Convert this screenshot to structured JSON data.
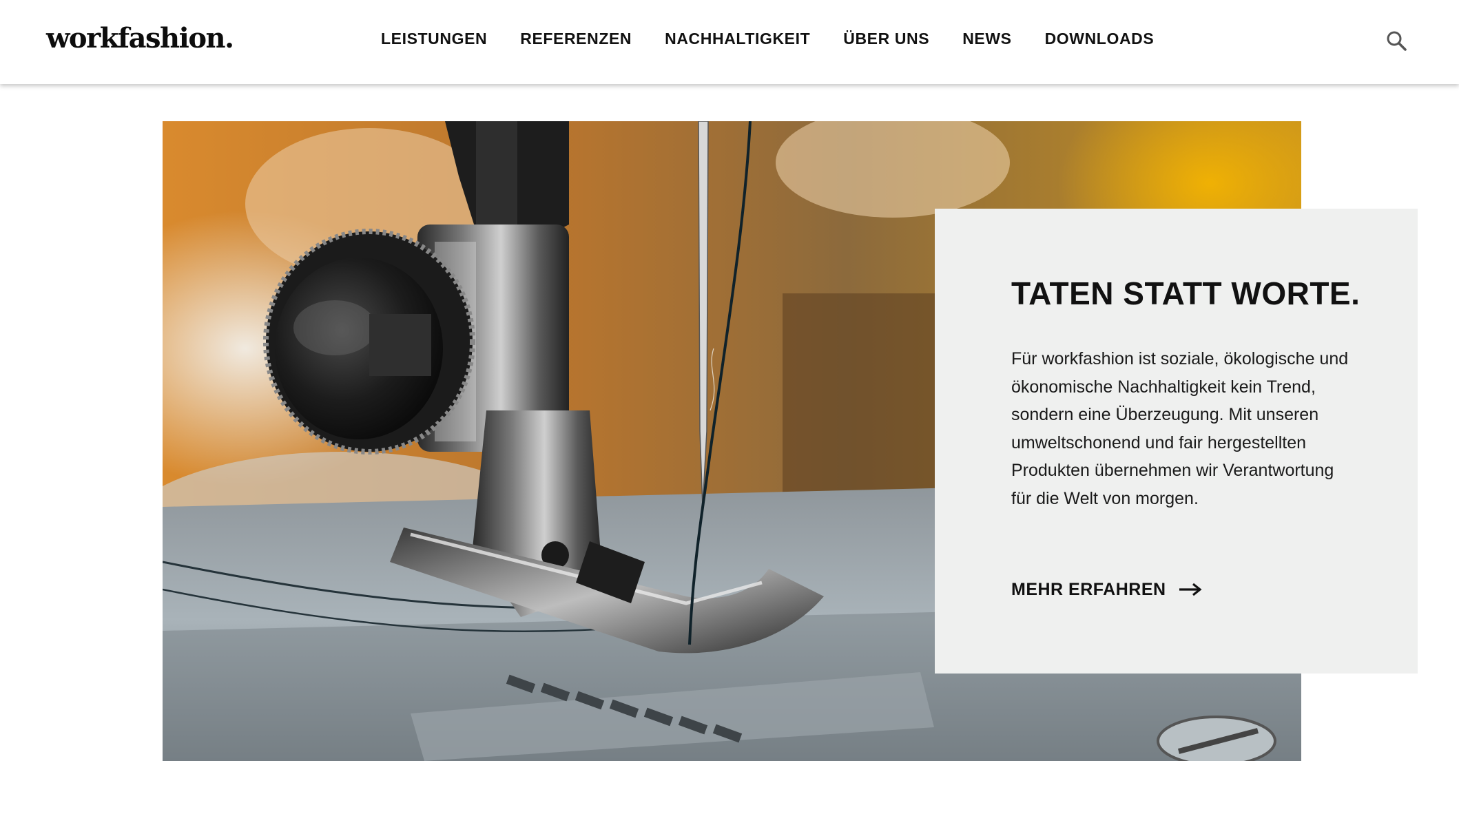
{
  "header": {
    "logo": "workfashion.",
    "nav": [
      {
        "label": "LEISTUNGEN"
      },
      {
        "label": "REFERENZEN"
      },
      {
        "label": "NACHHALTIGKEIT"
      },
      {
        "label": "ÜBER UNS"
      },
      {
        "label": "NEWS"
      },
      {
        "label": "DOWNLOADS"
      }
    ],
    "search_icon": "search-icon"
  },
  "hero": {
    "image": "sewing-machine-presser-foot-photo"
  },
  "card": {
    "title": "TATEN STATT WORTE.",
    "text_lines": [
      "Für workfashion ist soziale, ökologische und",
      "ökonomische Nachhaltigkeit kein Trend,",
      "sondern eine Überzeugung. Mit unseren",
      "umweltschonend und fair hergestellten",
      "Produkten übernehmen wir Verantwortung",
      "für die Welt von morgen."
    ],
    "cta_label": "MEHR ERFAHREN",
    "cta_icon": "arrow-right-icon",
    "background": "#eff0ef"
  }
}
